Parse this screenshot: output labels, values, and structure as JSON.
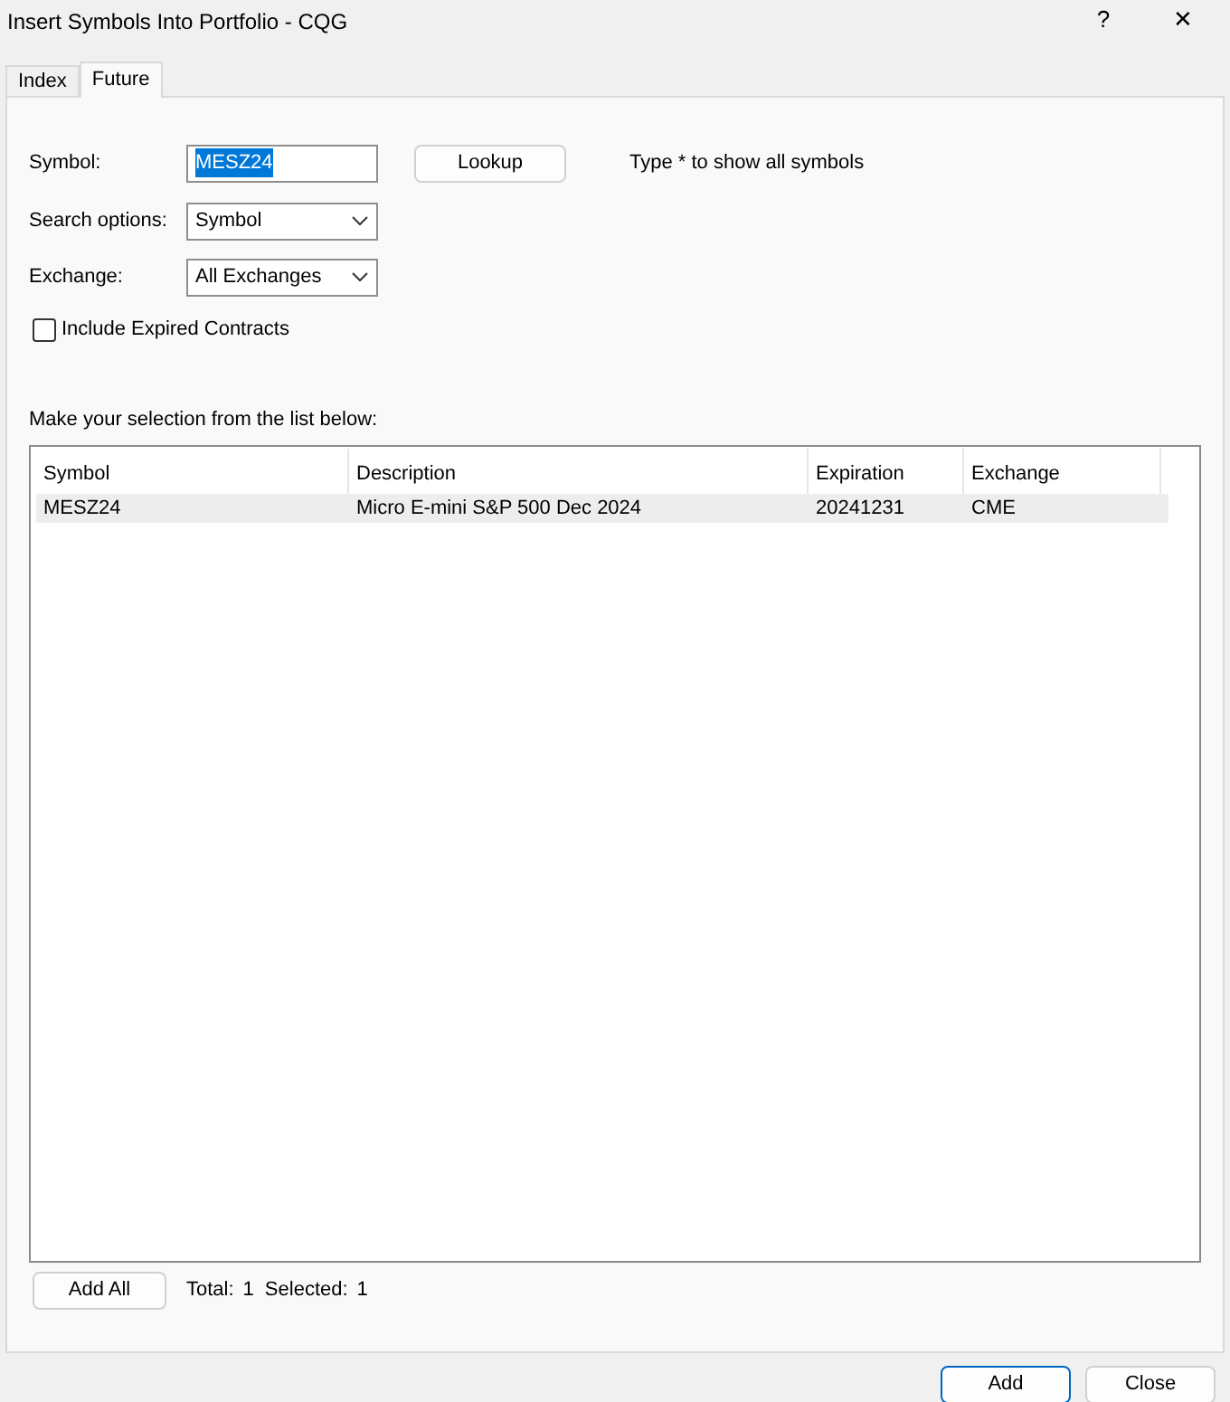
{
  "window": {
    "title": "Insert Symbols Into Portfolio - CQG",
    "help": "?",
    "close": "✕"
  },
  "tabs": [
    {
      "label": "Index",
      "selected": false
    },
    {
      "label": "Future",
      "selected": true
    }
  ],
  "symbol": {
    "label": "Symbol:",
    "value": "MESZ24",
    "value_selected": true
  },
  "lookup_button": "Lookup",
  "hint": "Type * to show all symbols",
  "search_options": {
    "label": "Search options:",
    "value": "Symbol"
  },
  "exchange": {
    "label": "Exchange:",
    "value": "All Exchanges"
  },
  "include_expired": {
    "label": "Include Expired Contracts",
    "checked": false
  },
  "list_caption": "Make your selection from the list below:",
  "table": {
    "columns": [
      "Symbol",
      "Description",
      "Expiration",
      "Exchange"
    ],
    "rows": [
      {
        "cells": [
          "MESZ24",
          "Micro E-mini S&P 500 Dec 2024",
          "20241231",
          "CME"
        ],
        "selected": true
      }
    ]
  },
  "add_all_button": "Add All",
  "total": {
    "label": "Total:",
    "value": "1"
  },
  "selected_count": {
    "label": "Selected:",
    "value": "1"
  },
  "buttons": [
    {
      "label": "Add",
      "default": true
    },
    {
      "label": "Close",
      "default": false
    }
  ]
}
